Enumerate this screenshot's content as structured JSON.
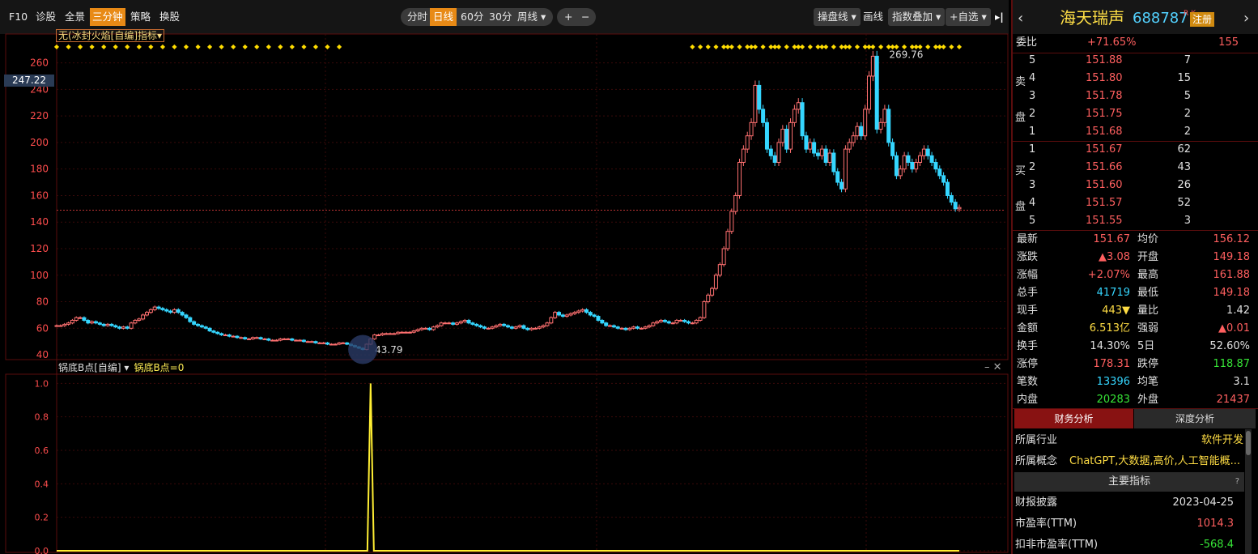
{
  "toolbar": {
    "items": [
      "F10",
      "诊股",
      "全景",
      "三分钟",
      "策略",
      "换股"
    ],
    "active": "三分钟",
    "periods": [
      "分时",
      "日线",
      "60分",
      "30分",
      "周线 ▾"
    ],
    "active_period": "日线",
    "zoom_in": "+",
    "zoom_out": "−",
    "right_tools": [
      "操盘线 ▾",
      "画线",
      "指数叠加 ▾",
      "+自选 ▾"
    ],
    "collapse": "▸|"
  },
  "indicator_selector": "无(冰封火焰[自编]指标▾",
  "price_marker": "247.22",
  "sub_panel": {
    "title": "锅底B点[自编] ▾",
    "value": "锅底B点=0",
    "controls": "– ✕"
  },
  "chart_data": [
    {
      "type": "candlestick",
      "title": "",
      "y_ticks": [
        40,
        60,
        80,
        100,
        120,
        140,
        160,
        180,
        200,
        220,
        240,
        260
      ],
      "ylim": [
        37,
        275
      ],
      "high_label": "269.76",
      "low_label": "43.79",
      "reference_line": 149,
      "closes": [
        62,
        62,
        63,
        64,
        66,
        68,
        68,
        66,
        64,
        65,
        64,
        63,
        62,
        63,
        62,
        61,
        60,
        61,
        60,
        64,
        66,
        67,
        70,
        72,
        74,
        76,
        75,
        74,
        73,
        72,
        74,
        72,
        70,
        68,
        65,
        63,
        62,
        61,
        60,
        58,
        57,
        56,
        55,
        55,
        54,
        54,
        53,
        53,
        52,
        52,
        53,
        53,
        52,
        52,
        51,
        51,
        51,
        52,
        52,
        52,
        51,
        51,
        51,
        50,
        50,
        50,
        49,
        49,
        49,
        48,
        48,
        48,
        49,
        49,
        48,
        47,
        46,
        45,
        44,
        48,
        52,
        55,
        55,
        56,
        56,
        56,
        56,
        57,
        57,
        57,
        57,
        58,
        59,
        60,
        60,
        59,
        61,
        62,
        64,
        64,
        64,
        63,
        64,
        65,
        66,
        64,
        63,
        62,
        61,
        60,
        60,
        61,
        62,
        63,
        62,
        61,
        60,
        61,
        62,
        60,
        59,
        60,
        60,
        61,
        62,
        64,
        68,
        72,
        70,
        69,
        70,
        71,
        72,
        73,
        74,
        72,
        70,
        69,
        66,
        64,
        62,
        62,
        61,
        60,
        60,
        59,
        60,
        61,
        60,
        60,
        61,
        62,
        64,
        65,
        66,
        65,
        64,
        64,
        66,
        66,
        65,
        64,
        64,
        66,
        68,
        80,
        85,
        90,
        100,
        108,
        120,
        133,
        148,
        160,
        185,
        195,
        205,
        215,
        243,
        225,
        215,
        195,
        190,
        185,
        200,
        210,
        195,
        215,
        225,
        230,
        205,
        195,
        200,
        192,
        190,
        195,
        185,
        192,
        178,
        170,
        165,
        195,
        200,
        205,
        212,
        205,
        225,
        250,
        265,
        210,
        215,
        225,
        200,
        190,
        175,
        180,
        190,
        185,
        180,
        185,
        190,
        195,
        190,
        185,
        180,
        175,
        170,
        160,
        155,
        150,
        151
      ]
    },
    {
      "type": "line",
      "title": "锅底B点",
      "y_ticks": [
        0.0,
        0.2,
        0.4,
        0.6,
        0.8,
        1.0
      ],
      "ylim": [
        0,
        1.05
      ],
      "spike_index": 80,
      "value": 0
    }
  ],
  "right_panel": {
    "name": "海天瑞声",
    "code": "688787",
    "rk": "R K",
    "register": "注册",
    "weibi": {
      "label": "委比",
      "value": "+71.65%",
      "diff": "155"
    },
    "sell_label": "卖盘",
    "buy_label": "买盘",
    "sell": [
      [
        "5",
        "151.88",
        "7"
      ],
      [
        "4",
        "151.80",
        "15"
      ],
      [
        "3",
        "151.78",
        "5"
      ],
      [
        "2",
        "151.75",
        "2"
      ],
      [
        "1",
        "151.68",
        "2"
      ]
    ],
    "buy": [
      [
        "1",
        "151.67",
        "62"
      ],
      [
        "2",
        "151.66",
        "43"
      ],
      [
        "3",
        "151.60",
        "26"
      ],
      [
        "4",
        "151.57",
        "52"
      ],
      [
        "5",
        "151.55",
        "3"
      ]
    ],
    "stats": [
      [
        "最新",
        "151.67",
        "red",
        "均价",
        "156.12",
        "red"
      ],
      [
        "涨跌",
        "▲3.08",
        "red",
        "开盘",
        "149.18",
        "red"
      ],
      [
        "涨幅",
        "+2.07%",
        "red",
        "最高",
        "161.88",
        "red"
      ],
      [
        "总手",
        "41719",
        "cyn",
        "最低",
        "149.18",
        "red"
      ],
      [
        "现手",
        "443▼",
        "yel",
        "量比",
        "1.42",
        "wht"
      ],
      [
        "金额",
        "6.513亿",
        "yel",
        "强弱",
        "▲0.01",
        "red"
      ],
      [
        "换手",
        "14.30%",
        "wht",
        "5日",
        "52.60%",
        "wht"
      ],
      [
        "涨停",
        "178.31",
        "red",
        "跌停",
        "118.87",
        "grn"
      ],
      [
        "笔数",
        "13396",
        "cyn",
        "均笔",
        "3.1",
        "wht"
      ],
      [
        "内盘",
        "20283",
        "grn",
        "外盘",
        "21437",
        "red"
      ]
    ],
    "tab_fin": "财务分析",
    "tab_depth": "深度分析",
    "industry": {
      "label": "所属行业",
      "value": "软件开发"
    },
    "concept": {
      "label": "所属概念",
      "value": "ChatGPT,大数据,高价,人工智能概..."
    },
    "main_indicator": "主要指标",
    "help": "?",
    "fin_rows": [
      [
        "财报披露",
        "2023-04-25",
        "wht"
      ],
      [
        "市盈率(TTM)",
        "1014.3",
        "red"
      ],
      [
        "扣非市盈率(TTM)",
        "-568.4",
        "grn"
      ]
    ]
  }
}
